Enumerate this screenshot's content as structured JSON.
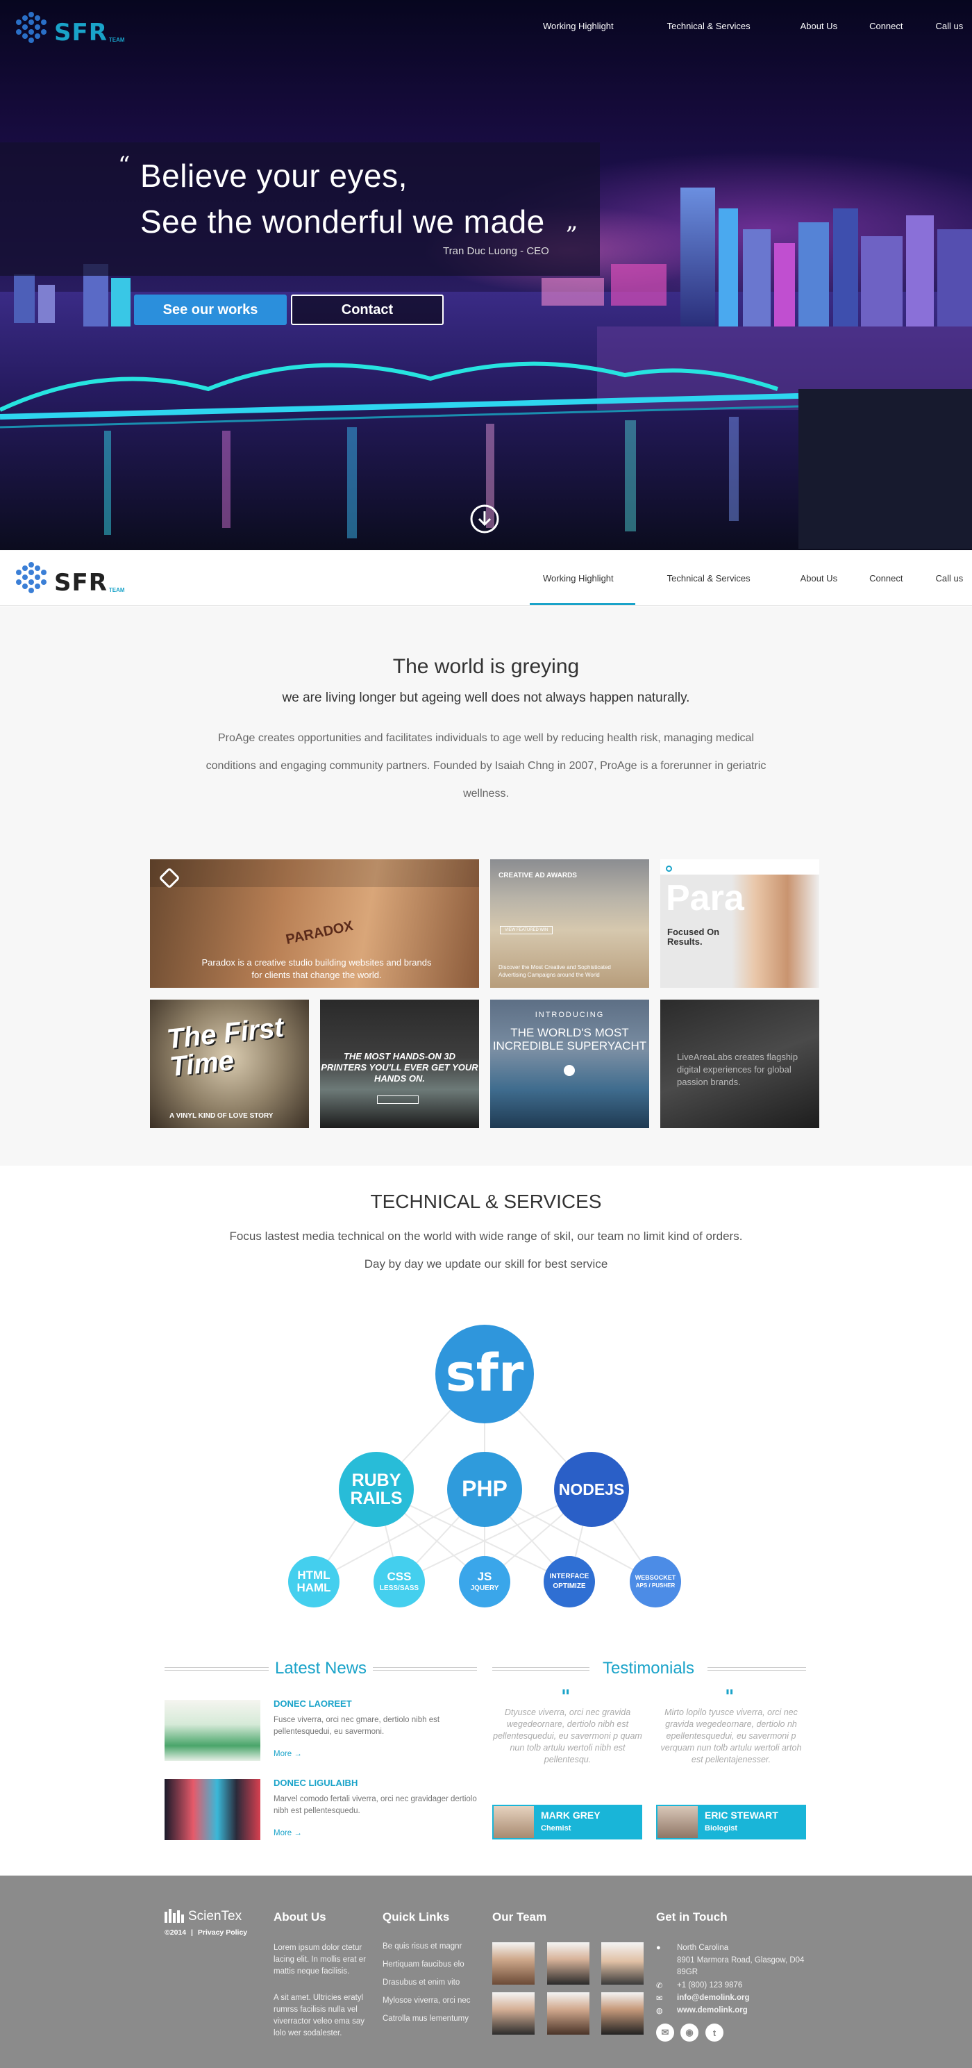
{
  "brand": {
    "logo_text": "SFR",
    "logo_sub": "TEAM",
    "accent": "#1aa3c9"
  },
  "nav": {
    "items": [
      "Working Highlight",
      "Technical & Services",
      "About Us",
      "Connect",
      "Call us"
    ],
    "active": "Working Highlight"
  },
  "hero": {
    "quote_line1": "Believe your eyes,",
    "quote_line2": "See the wonderful we made",
    "author": "Tran Duc Luong - CEO",
    "btn_works": "See our works",
    "btn_contact": "Contact"
  },
  "intro": {
    "title": "The world is greying",
    "subtitle": "we are living longer but ageing well does not always happen naturally.",
    "body": "ProAge creates opportunities and facilitates individuals to age well by reducing health risk, managing medical conditions and engaging community partners. Founded by Isaiah Chng in 2007, ProAge is a forerunner in geriatric wellness."
  },
  "portfolio": {
    "paradox_caption": "Paradox is a creative studio building websites and brands for clients that change the world.",
    "paradox_logo": "PARADOX",
    "awards_title": "CREATIVE AD AWARDS",
    "awards_btn": "VIEW FEATURED WIN",
    "awards_caption": "Discover the Most Creative and Sophisticated Advertising Campaigns around the World",
    "para_title": "Para",
    "para_focused": "Focused On Results.",
    "first_time_title": "The First Time",
    "first_time_caption": "A VINYL KIND OF LOVE STORY",
    "printers_text": "THE MOST HANDS-ON 3D PRINTERS YOU'LL EVER GET YOUR HANDS ON.",
    "yacht_intro": "INTRODUCING",
    "yacht_title": "THE WORLD'S MOST INCREDIBLE SUPERYACHT",
    "livearea_caption": "LiveAreaLabs creates flagship digital experiences for global passion brands."
  },
  "tech": {
    "title": "TECHNICAL & SERVICES",
    "line1": "Focus lastest media technical on the world with wide range of skil, our team no limit kind of orders.",
    "line2": "Day by day we update our skill for best service",
    "root": "sfr",
    "mid": [
      {
        "label": "RUBY RAILS",
        "color": "#28bcd8"
      },
      {
        "label": "PHP",
        "color": "#2f9bdc"
      },
      {
        "label": "NODEJS",
        "color": "#2a5fc7"
      }
    ],
    "leaves": [
      {
        "main": "HTML HAML",
        "sub": "",
        "color": "#44cfee"
      },
      {
        "main": "CSS",
        "sub": "LESS/SASS",
        "color": "#44cfee"
      },
      {
        "main": "JS",
        "sub": "JQUERY",
        "color": "#3aa6ea"
      },
      {
        "main": "INTERFACE",
        "sub": "OPTIMIZE",
        "color": "#2f6fd3"
      },
      {
        "main": "WEBSOCKET",
        "sub": "APS / PUSHER",
        "color": "#4c8ce6"
      }
    ]
  },
  "news": {
    "title": "Latest News",
    "items": [
      {
        "title": "DONEC LAOREET",
        "body": "Fusce viverra, orci nec gmare, dertiolo nibh est pellentesquedui, eu savermoni.",
        "more": "More →"
      },
      {
        "title": "DONEC LIGULAIBH",
        "body": "Marvel comodo fertali viverra, orci nec gravidager dertiolo nibh est pellentesquedu.",
        "more": "More →"
      }
    ]
  },
  "testimonials": {
    "title": "Testimonials",
    "items": [
      {
        "text": "Dtyusce viverra, orci nec gravida wegedeornare, dertiolo nibh est pellentesquedui, eu savermoni p quam nun tolb artulu wertoli nibh est pellentesqu.",
        "name": "MARK GREY",
        "role": "Chemist"
      },
      {
        "text": "Mirto lopilo tyusce viverra, orci nec gravida wegedeornare, dertiolo nh epellentesquedui, eu savermoni p verquam nun tolb artulu wertoli artoh est pellentajenesser.",
        "name": "ERIC STEWART",
        "role": "Biologist"
      }
    ]
  },
  "footer": {
    "logo": "ScienTex",
    "copyright": "©2014",
    "privacy": "Privacy Policy",
    "about_title": "About Us",
    "about_p1": "Lorem ipsum dolor ctetur lacing elit. In mollis erat er mattis neque facilisis.",
    "about_p2": "A sit amet. Ultricies eratyl rumrss facilisis nulla vel viverractor veleo ema say lolo wer sodalester.",
    "links_title": "Quick Links",
    "links": [
      "Be quis risus et magnr",
      "Hertiquam faucibus elo",
      "Drasubus et enim vito",
      "Mylosce viverra, orci nec",
      "Catrolla mus lementumy"
    ],
    "team_title": "Our Team",
    "contact_title": "Get in Touch",
    "address1": "North Carolina",
    "address2": "8901 Marmora Road, Glasgow, D04 89GR",
    "phone": "+1 (800) 123 9876",
    "email": "info@demolink.org",
    "web": "www.demolink.org"
  }
}
